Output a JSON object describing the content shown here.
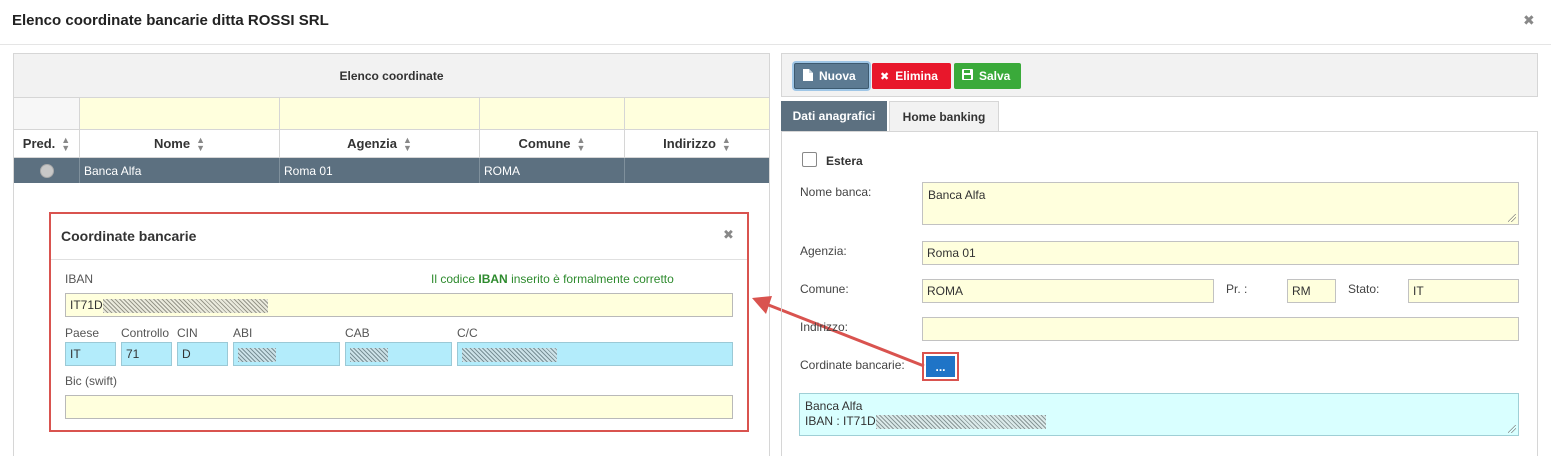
{
  "window": {
    "title": "Elenco coordinate bancarie ditta ROSSI SRL",
    "close_glyph": "✖"
  },
  "list_panel": {
    "header": "Elenco coordinate",
    "columns": [
      {
        "label": "Pred."
      },
      {
        "label": "Nome"
      },
      {
        "label": "Agenzia"
      },
      {
        "label": "Comune"
      },
      {
        "label": "Indirizzo"
      }
    ],
    "rows": [
      {
        "nome": "Banca Alfa",
        "agenzia": "Roma 01",
        "comune": "ROMA",
        "indirizzo": ""
      }
    ]
  },
  "popup": {
    "title": "Coordinate bancarie",
    "close_glyph": "✖",
    "iban_label": "IBAN",
    "iban_message_pre": "Il codice",
    "iban_message_strong": "IBAN",
    "iban_message_post": "inserito è formalmente corretto",
    "iban_value": "IT71D",
    "fields": {
      "paese": {
        "label": "Paese",
        "value": "IT"
      },
      "controllo": {
        "label": "Controllo",
        "value": "71"
      },
      "cin": {
        "label": "CIN",
        "value": "D"
      },
      "abi": {
        "label": "ABI",
        "value": ""
      },
      "cab": {
        "label": "CAB",
        "value": ""
      },
      "cc": {
        "label": "C/C",
        "value": ""
      }
    },
    "bic_label": "Bic (swift)",
    "bic_value": ""
  },
  "toolbar": {
    "nuova": "Nuova",
    "elimina": "Elimina",
    "salva": "Salva"
  },
  "tabs": [
    {
      "label": "Dati anagrafici",
      "active": true
    },
    {
      "label": "Home banking",
      "active": false
    }
  ],
  "form": {
    "estera_label": "Estera",
    "nome_banca_label": "Nome banca:",
    "nome_banca_value": "Banca Alfa",
    "agenzia_label": "Agenzia:",
    "agenzia_value": "Roma 01",
    "comune_label": "Comune:",
    "comune_value": "ROMA",
    "pr_label": "Pr. :",
    "pr_value": "RM",
    "stato_label": "Stato:",
    "stato_value": "IT",
    "indirizzo_label": "Indirizzo:",
    "indirizzo_value": "",
    "coordinate_label": "Cordinate bancarie:",
    "coordinate_button": "...",
    "summary_line1": "Banca Alfa",
    "summary_line2": "IBAN : IT71D"
  },
  "colors": {
    "row_selected": "#5c7080",
    "input_yellow": "#ffffdd",
    "input_cyan": "#b3ecfb",
    "highlight_red": "#d9534f",
    "btn_delete": "#e8172b",
    "btn_save": "#3aaa3a",
    "btn_primary": "#1f74c7",
    "success_text": "#2e8b2e"
  },
  "icons": {
    "nuova": "file-icon",
    "elimina": "x-icon",
    "salva": "floppy-disk-icon",
    "sort": "sort-icon"
  }
}
